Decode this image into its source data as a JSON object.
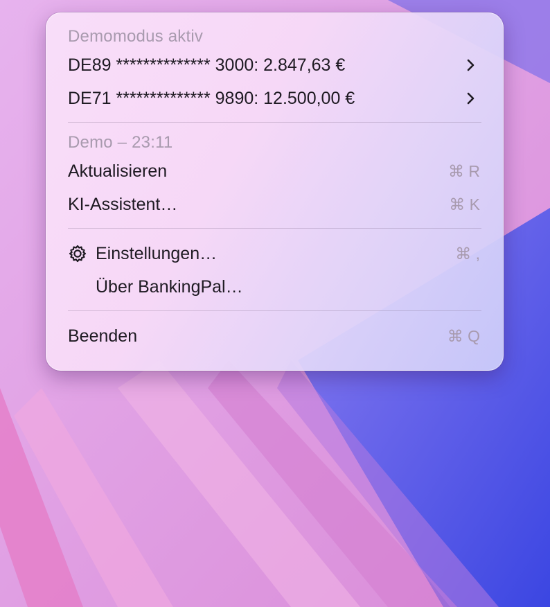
{
  "menu": {
    "section1": {
      "header": "Demomodus aktiv",
      "accounts": [
        {
          "label": "DE89 ************** 3000:  2.847,63 €"
        },
        {
          "label": "DE71 ************** 9890:  12.500,00 €"
        }
      ]
    },
    "section2": {
      "header": "Demo – 23:11",
      "items": [
        {
          "label": "Aktualisieren",
          "shortcut": "⌘ R"
        },
        {
          "label": "KI-Assistent…",
          "shortcut": "⌘ K"
        }
      ]
    },
    "section3": {
      "items": [
        {
          "label": "Einstellungen…",
          "shortcut": "⌘ ,",
          "icon": "gear-icon"
        },
        {
          "label": "Über BankingPal…",
          "shortcut": ""
        }
      ]
    },
    "section4": {
      "items": [
        {
          "label": "Beenden",
          "shortcut": "⌘ Q"
        }
      ]
    }
  },
  "colors": {
    "text": "#1e1a22",
    "secondary_text": "#a89aae",
    "separator": "#b8a8c0"
  }
}
